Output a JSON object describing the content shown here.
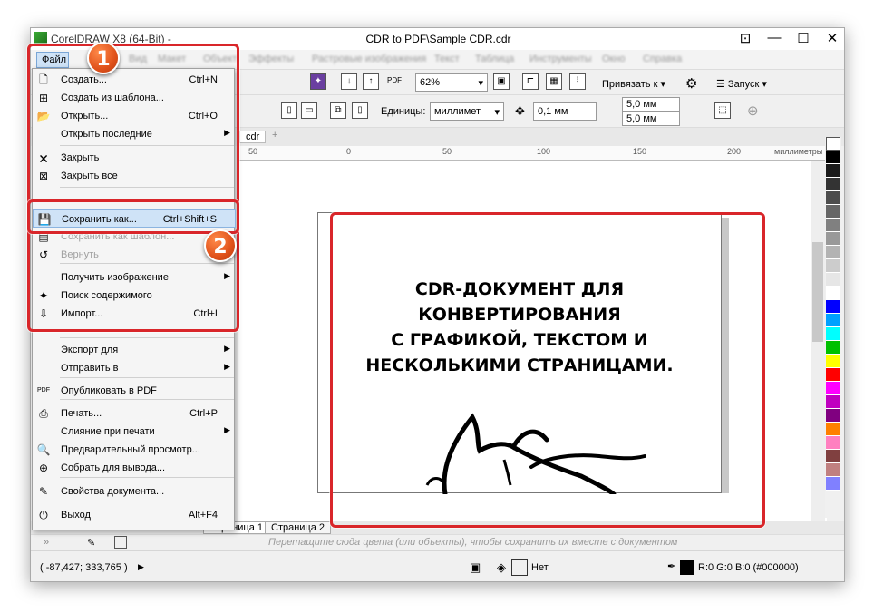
{
  "window": {
    "title": "CDR to PDF\\Sample CDR.cdr",
    "app_name": "CorelDRAW X8 (64-Bit) -"
  },
  "menubar": {
    "file_label": "Файл",
    "blurred_items": [
      "Вид",
      "Макет",
      "Объект",
      "Эффекты",
      "Растровые изображения",
      "Текст",
      "Таблица",
      "Инструменты",
      "Окно",
      "Справка"
    ]
  },
  "toolbar": {
    "zoom_value": "62%",
    "snap_label": "Привязать к",
    "launch_label": "Запуск",
    "units_label": "Единицы:",
    "units_value": "миллимет",
    "nudge_value": "0,1 мм",
    "dup_x": "5,0 мм",
    "dup_y": "5,0 мм",
    "doc_tab": "cdr"
  },
  "ruler": {
    "ticks": [
      "50",
      "0",
      "50",
      "100",
      "150",
      "200"
    ],
    "units": "миллиметры"
  },
  "file_menu": {
    "items": [
      {
        "label": "Создать...",
        "shortcut": "Ctrl+N",
        "icon": "new-doc-icon"
      },
      {
        "label": "Создать из шаблона...",
        "shortcut": "",
        "icon": "new-from-template-icon"
      },
      {
        "label": "Открыть...",
        "shortcut": "Ctrl+O",
        "icon": "folder-open-icon"
      },
      {
        "label": "Открыть последние",
        "shortcut": "",
        "icon": "",
        "submenu": true
      },
      {
        "label": "Закрыть",
        "shortcut": "",
        "icon": "close-doc-icon"
      },
      {
        "label": "Закрыть все",
        "shortcut": "",
        "icon": "close-all-icon"
      },
      {
        "label": "Сохранить как...",
        "shortcut": "Ctrl+Shift+S",
        "icon": "save-as-icon"
      },
      {
        "label": "Сохранить как шаблон...",
        "shortcut": "",
        "icon": "save-template-icon"
      },
      {
        "label": "Вернуть",
        "shortcut": "",
        "icon": "revert-icon"
      },
      {
        "label": "Получить изображение",
        "shortcut": "",
        "icon": "",
        "submenu": true
      },
      {
        "label": "Поиск содержимого",
        "shortcut": "",
        "icon": "search-content-icon"
      },
      {
        "label": "Импорт...",
        "shortcut": "Ctrl+I",
        "icon": "import-icon"
      },
      {
        "label": "Экспорт для",
        "shortcut": "",
        "icon": "",
        "submenu": true
      },
      {
        "label": "Отправить в",
        "shortcut": "",
        "icon": "",
        "submenu": true
      },
      {
        "label": "Опубликовать в PDF",
        "shortcut": "",
        "icon": "pdf-icon"
      },
      {
        "label": "Печать...",
        "shortcut": "Ctrl+P",
        "icon": "print-icon"
      },
      {
        "label": "Слияние при печати",
        "shortcut": "",
        "icon": "",
        "submenu": true
      },
      {
        "label": "Предварительный просмотр...",
        "shortcut": "",
        "icon": "print-preview-icon"
      },
      {
        "label": "Собрать для вывода...",
        "shortcut": "",
        "icon": "collect-output-icon"
      },
      {
        "label": "Свойства документа...",
        "shortcut": "",
        "icon": "doc-properties-icon"
      },
      {
        "label": "Выход",
        "shortcut": "Alt+F4",
        "icon": "power-icon"
      }
    ]
  },
  "badges": {
    "one": "1",
    "two": "2"
  },
  "document": {
    "line1": "CDR-ДОКУМЕНТ ДЛЯ КОНВЕРТИРОВАНИЯ",
    "line2": "С ГРАФИКОЙ, ТЕКСТОМ И",
    "line3": "НЕСКОЛЬКИМИ СТРАНИЦАМИ."
  },
  "page_tabs": {
    "page1": "Страница 1",
    "page2": "Страница 2"
  },
  "colorbar": {
    "hint": "Перетащите сюда цвета (или объекты), чтобы сохранить их вместе с документом"
  },
  "status": {
    "coords": "( -87,427; 333,765 )",
    "fill": "Нет",
    "color": "R:0 G:0 B:0 (#000000)"
  },
  "palette_colors": [
    "#ffffff",
    "#000000",
    "#1a1a1a",
    "#333333",
    "#4d4d4d",
    "#666666",
    "#808080",
    "#999999",
    "#b3b3b3",
    "#cccccc",
    "#e6e6e6",
    "#ffffff",
    "#0000ff",
    "#00a0ff",
    "#00ffff",
    "#00c000",
    "#ffff00",
    "#ff0000",
    "#ff00ff",
    "#c000c0",
    "#800080",
    "#ff8000",
    "#ff80c0",
    "#804040",
    "#c08080",
    "#8080ff"
  ]
}
